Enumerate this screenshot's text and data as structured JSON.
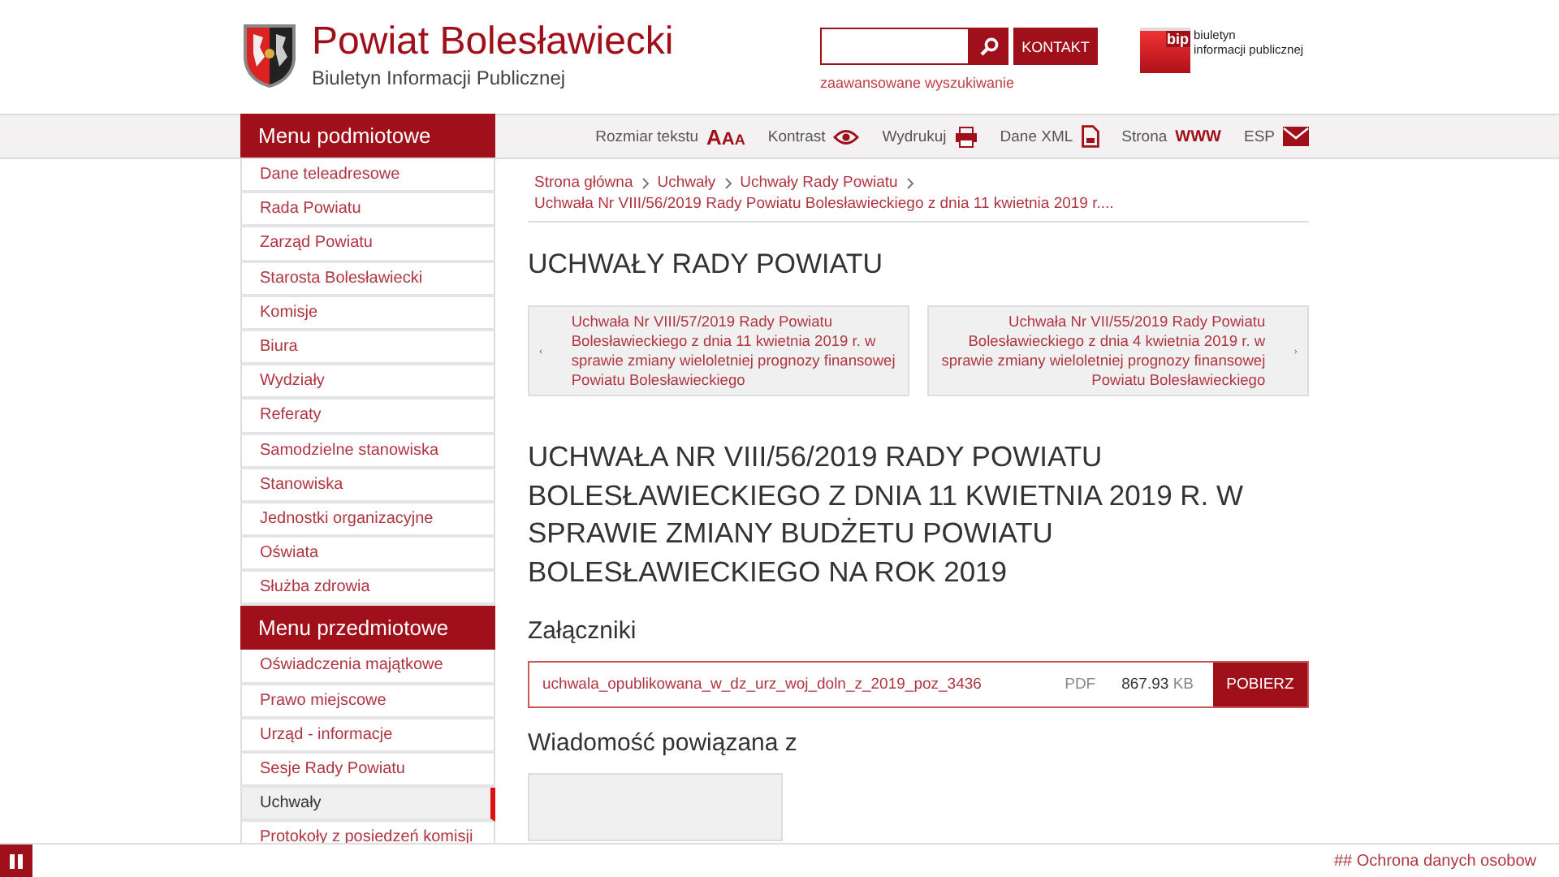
{
  "header": {
    "title": "Powiat Bolesławiecki",
    "subtitle": "Biuletyn Informacji Publicznej",
    "contact_button": "KONTAKT",
    "advanced_search": "zaawansowane wyszukiwanie",
    "bip_logo": {
      "mark": "bip",
      "line1": "biuletyn",
      "line2": "informacji publicznej"
    }
  },
  "toolbar": [
    {
      "label": "Rozmiar tekstu",
      "kind": "text-size",
      "glyph": "AAA"
    },
    {
      "label": "Kontrast",
      "kind": "contrast"
    },
    {
      "label": "Wydrukuj",
      "kind": "print"
    },
    {
      "label": "Dane XML",
      "kind": "xml"
    },
    {
      "label": "Strona",
      "kind": "www",
      "glyph": "WWW"
    },
    {
      "label": "ESP",
      "kind": "email"
    }
  ],
  "sidebar": [
    {
      "title": "Menu podmiotowe",
      "items": [
        {
          "label": "Dane teleadresowe",
          "selected": false
        },
        {
          "label": "Rada Powiatu",
          "selected": false
        },
        {
          "label": "Zarząd Powiatu",
          "selected": false
        },
        {
          "label": "Starosta Bolesławiecki",
          "selected": false
        },
        {
          "label": "Komisje",
          "selected": false
        },
        {
          "label": "Biura",
          "selected": false
        },
        {
          "label": "Wydziały",
          "selected": false
        },
        {
          "label": "Referaty",
          "selected": false
        },
        {
          "label": "Samodzielne stanowiska",
          "selected": false
        },
        {
          "label": "Stanowiska",
          "selected": false
        },
        {
          "label": "Jednostki organizacyjne",
          "selected": false
        },
        {
          "label": "Oświata",
          "selected": false
        },
        {
          "label": "Służba zdrowia",
          "selected": false
        }
      ]
    },
    {
      "title": "Menu przedmiotowe",
      "items": [
        {
          "label": "Oświadczenia majątkowe",
          "selected": false
        },
        {
          "label": "Prawo miejscowe",
          "selected": false
        },
        {
          "label": "Urząd - informacje",
          "selected": false
        },
        {
          "label": "Sesje Rady Powiatu",
          "selected": false
        },
        {
          "label": "Uchwały",
          "selected": true
        },
        {
          "label": "Protokoły z posiedzeń komisji",
          "selected": false
        }
      ]
    }
  ],
  "breadcrumb": [
    "Strona główna",
    "Uchwały",
    "Uchwały Rady Powiatu",
    "Uchwała Nr VIII/56/2019 Rady Powiatu Bolesławieckiego z dnia 11 kwietnia 2019 r...."
  ],
  "section_title": "UCHWAŁY RADY POWIATU",
  "neighbours": {
    "previous": "Uchwała Nr VIII/57/2019 Rady Powiatu Bolesławieckiego z dnia 11 kwietnia 2019 r. w sprawie zmiany wieloletniej prognozy finansowej Powiatu Bolesławieckiego",
    "next": "Uchwała Nr VII/55/2019 Rady Powiatu Bolesławieckiego z dnia 4 kwietnia 2019 r. w sprawie zmiany wieloletniej prognozy finansowej Powiatu Bolesławieckiego"
  },
  "document_title": "UCHWAŁA NR VIII/56/2019 RADY POWIATU BOLESŁAWIECKIEGO Z DNIA 11 KWIETNIA 2019 R. W SPRAWIE ZMIANY BUDŻETU POWIATU BOLESŁAWIECKIEGO NA ROK 2019",
  "attachments": {
    "heading": "Załączniki",
    "files": [
      {
        "name": "uchwala_opublikowana_w_dz_urz_woj_doln_z_2019_poz_3436",
        "type": "PDF",
        "size": "867.93",
        "unit": "KB",
        "button": "POBIERZ"
      }
    ]
  },
  "related": {
    "heading": "Wiadomość powiązana z"
  },
  "footer": {
    "text": "## Ochrona danych osobow"
  }
}
